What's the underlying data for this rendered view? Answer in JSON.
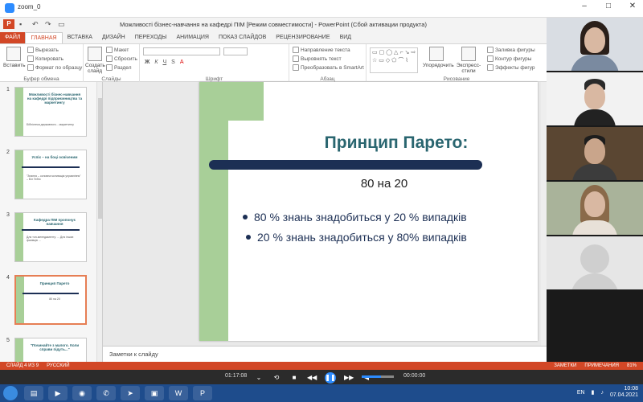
{
  "zoom": {
    "window_title": "zoom_0"
  },
  "powerpoint": {
    "doc_title": "Можливості бізнес-навчання на кафедрі ПІМ [Режим совместимости] - PowerPoint (Сбой активации продукта)",
    "logo": "P",
    "tabs": [
      "ФАЙЛ",
      "ГЛАВНАЯ",
      "ВСТАВКА",
      "ДИЗАЙН",
      "ПЕРЕХОДЫ",
      "АНИМАЦИЯ",
      "ПОКАЗ СЛАЙДОВ",
      "РЕЦЕНЗИРОВАНИЕ",
      "ВИД"
    ],
    "ribbon": {
      "clipboard": {
        "paste": "Вставить",
        "cut": "Вырезать",
        "copy": "Копировать",
        "format_painter": "Формат по образцу",
        "label": "Буфер обмена"
      },
      "slides": {
        "new_slide": "Создать слайд",
        "layout": "Макет",
        "reset": "Сбросить",
        "section": "Раздел",
        "label": "Слайды"
      },
      "font": {
        "label": "Шрифт"
      },
      "paragraph": {
        "text_direction": "Направление текста",
        "align_text": "Выровнять текст",
        "smartart": "Преобразовать в SmartArt",
        "label": "Абзац"
      },
      "drawing": {
        "arrange": "Упорядочить",
        "quick_styles": "Экспресс-стили",
        "shape_fill": "Заливка фигуры",
        "shape_outline": "Контур фигуры",
        "shape_effects": "Эффекты фигур",
        "label": "Рисование"
      }
    },
    "thumbnails": [
      {
        "num": "1",
        "title": "Можливості бізнес-навчання на кафедрі підприємництва та маркетингу",
        "text": "Бібліотека державного... маркетингу"
      },
      {
        "num": "2",
        "title": "Успіх – на боці освіченим",
        "text": "\"Знання – основна мотивація управління\" – Біл Гейтс"
      },
      {
        "num": "3",
        "title": "Кафедра ПІМ пропонує навчання",
        "text": "Для топ-менеджменту: ... Для інших фахівців ..."
      },
      {
        "num": "4",
        "title": "Принцип Парето",
        "text": "80 на 20"
      },
      {
        "num": "5",
        "title": "\"Починайте з малого. Коли справи підуть...\"",
        "text": ""
      }
    ],
    "slide": {
      "title": "Принцип Парето:",
      "subtitle": "80 на 20",
      "bullets": [
        "80 % знань знадобиться у 20 % випадків",
        "20 % знань знадобиться у 80% випадків"
      ]
    },
    "notes_placeholder": "Заметки к слайду",
    "status": {
      "slide_of": "СЛАЙД 4 ИЗ 9",
      "language": "РУССКИЙ",
      "notes": "ЗАМЕТКИ",
      "comments": "ПРИМЕЧАНИЯ",
      "zoom": "81%"
    }
  },
  "zoom_controls": {
    "elapsed": "01:17:08",
    "remaining": "00:00:00"
  },
  "taskbar": {
    "language": "EN",
    "time": "10:08",
    "date": "07.04.2021"
  },
  "colors": {
    "accent": "#d24726",
    "slide_title": "#2a6670",
    "slide_bar": "#1c2f54",
    "slide_green": "#a8cf98",
    "zoom_blue": "#2d8cff"
  }
}
